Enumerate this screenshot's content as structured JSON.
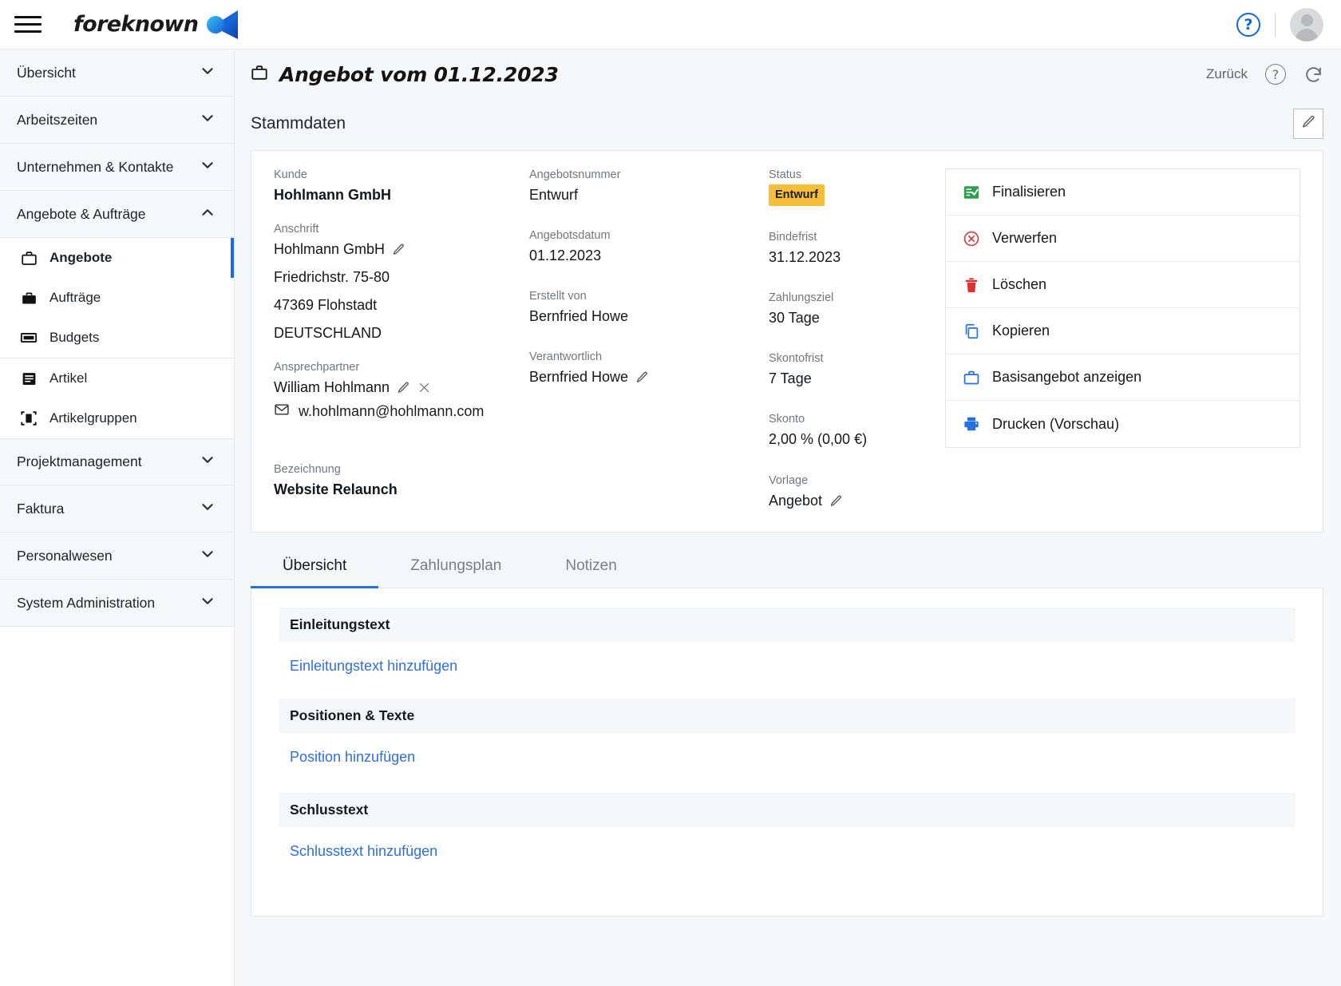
{
  "brand": {
    "name": "foreknown"
  },
  "topbar": {
    "menu_icon": "hamburger-menu-icon",
    "help_icon": "help-circle-icon",
    "avatar_icon": "user-avatar-icon"
  },
  "sidebar": {
    "groups": [
      {
        "label": "Übersicht",
        "expanded": false
      },
      {
        "label": "Arbeitszeiten",
        "expanded": false
      },
      {
        "label": "Unternehmen & Kontakte",
        "expanded": false
      },
      {
        "label": "Angebote & Aufträge",
        "expanded": true
      }
    ],
    "items": [
      {
        "label": "Angebote",
        "icon": "briefcase-outline-icon",
        "active": true
      },
      {
        "label": "Aufträge",
        "icon": "briefcase-filled-icon",
        "active": false
      },
      {
        "label": "Budgets",
        "icon": "banknote-icon",
        "active": false
      },
      {
        "label": "Artikel",
        "icon": "article-icon",
        "active": false
      },
      {
        "label": "Artikelgruppen",
        "icon": "article-group-icon",
        "active": false
      }
    ],
    "groups_bottom": [
      {
        "label": "Projektmanagement"
      },
      {
        "label": "Faktura"
      },
      {
        "label": "Personalwesen"
      },
      {
        "label": "System Administration"
      }
    ]
  },
  "page": {
    "title": "Angebot vom 01.12.2023",
    "title_icon": "briefcase-outline-icon",
    "back_label": "Zurück",
    "help_icon": "help-circle-icon",
    "refresh_icon": "refresh-icon",
    "section_title": "Stammdaten",
    "edit_icon": "pencil-icon"
  },
  "stammdaten": {
    "kunde": {
      "label": "Kunde",
      "value": "Hohlmann GmbH"
    },
    "anschrift": {
      "label": "Anschrift",
      "line1": "Hohlmann GmbH",
      "line2": "Friedrichstr. 75-80",
      "line3": "47369 Flohstadt",
      "line4": "DEUTSCHLAND"
    },
    "ansprechpartner": {
      "label": "Ansprechpartner",
      "value": "William Hohlmann",
      "email": "w.hohlmann@hohlmann.com"
    },
    "bezeichnung": {
      "label": "Bezeichnung",
      "value": "Website Relaunch"
    },
    "angebotsnummer": {
      "label": "Angebotsnummer",
      "value": "Entwurf"
    },
    "angebotsdatum": {
      "label": "Angebotsdatum",
      "value": "01.12.2023"
    },
    "erstellt_von": {
      "label": "Erstellt von",
      "value": "Bernfried Howe"
    },
    "verantwortlich": {
      "label": "Verantwortlich",
      "value": "Bernfried Howe"
    },
    "status": {
      "label": "Status",
      "value": "Entwurf",
      "color": "#f5bf3a"
    },
    "bindefrist": {
      "label": "Bindefrist",
      "value": "31.12.2023"
    },
    "zahlungsziel": {
      "label": "Zahlungsziel",
      "value": "30  Tage"
    },
    "skontofrist": {
      "label": "Skontofrist",
      "value": "7  Tage"
    },
    "skonto": {
      "label": "Skonto",
      "value": "2,00 %  (0,00 €)"
    },
    "vorlage": {
      "label": "Vorlage",
      "value": "Angebot"
    }
  },
  "actions": [
    {
      "label": "Finalisieren",
      "icon": "list-check-icon",
      "color": "#2e9e4f"
    },
    {
      "label": "Verwerfen",
      "icon": "circle-x-icon",
      "color": "#d93b3b"
    },
    {
      "label": "Löschen",
      "icon": "trash-icon",
      "color": "#e0322e"
    },
    {
      "label": "Kopieren",
      "icon": "copy-icon",
      "color": "#2572e0"
    },
    {
      "label": "Basisangebot anzeigen",
      "icon": "briefcase-outline-icon",
      "color": "#2572e0"
    },
    {
      "label": "Drucken (Vorschau)",
      "icon": "printer-icon",
      "color": "#2572e0"
    }
  ],
  "tabs": [
    {
      "label": "Übersicht",
      "active": true
    },
    {
      "label": "Zahlungsplan",
      "active": false
    },
    {
      "label": "Notizen",
      "active": false
    }
  ],
  "overview_sections": [
    {
      "heading": "Einleitungstext",
      "link": "Einleitungstext hinzufügen"
    },
    {
      "heading": "Positionen & Texte",
      "link": "Position hinzufügen"
    },
    {
      "heading": "Schlusstext",
      "link": "Schlusstext hinzufügen"
    }
  ],
  "colors": {
    "accent": "#2572e0",
    "link": "#2f6fe4",
    "warning": "#f5bf3a"
  }
}
